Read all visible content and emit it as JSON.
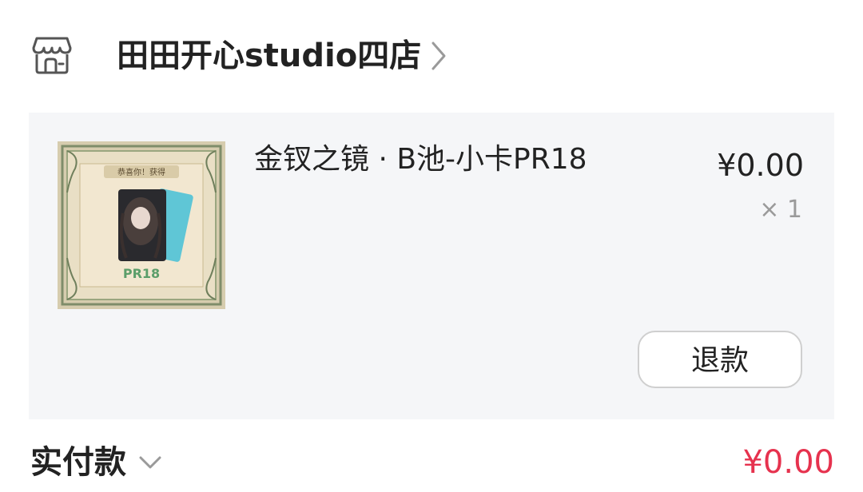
{
  "shop": {
    "name": "田田开心studio四店",
    "icon": "store-icon"
  },
  "item": {
    "title": "金钗之镜 · B池-小卡PR18",
    "price": "¥0.00",
    "quantity": "× 1",
    "thumbnail": {
      "banner": "恭喜你！获得",
      "card_code": "PR18"
    },
    "refund_label": "退款"
  },
  "payment": {
    "label": "实付款",
    "amount": "¥0.00",
    "amount_color": "#e6324e"
  }
}
